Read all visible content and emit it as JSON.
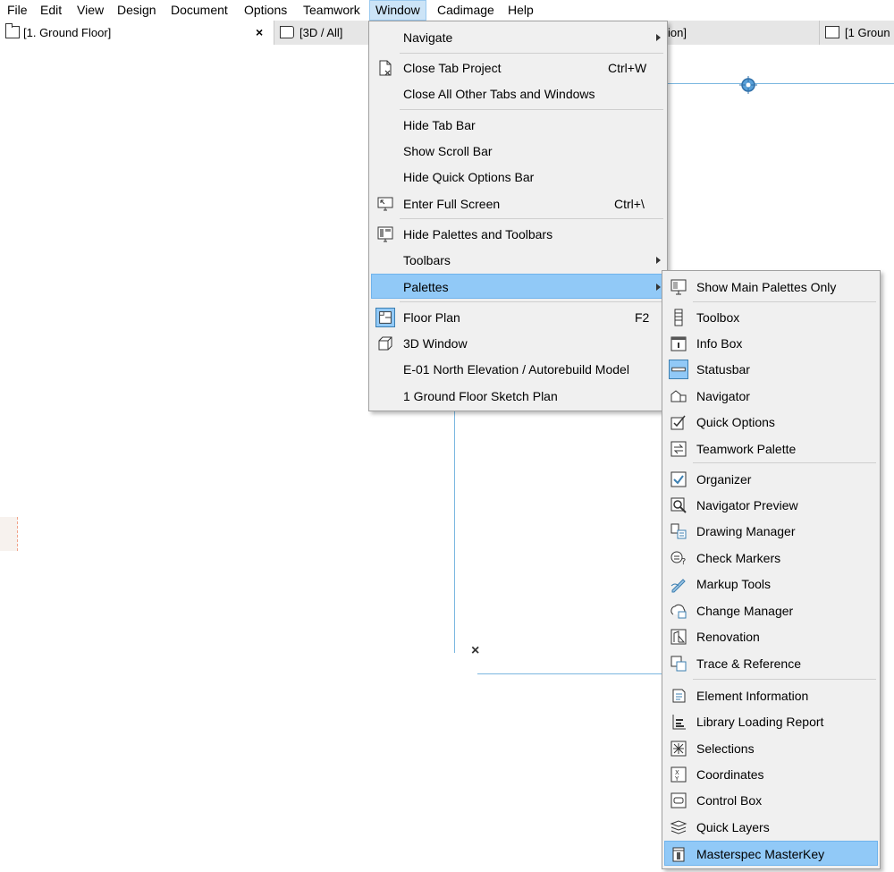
{
  "menubar": {
    "items": [
      "File",
      "Edit",
      "View",
      "Design",
      "Document",
      "Options",
      "Teamwork",
      "Window",
      "Cadimage",
      "Help"
    ],
    "active": "Window"
  },
  "tabs": {
    "floor_plan": "[1. Ground Floor]",
    "three_d": "[3D / All]",
    "partial": "ion]",
    "right": "[1 Groun",
    "close_glyph": "×"
  },
  "window_menu": {
    "navigate": "Navigate",
    "close_tab_project": "Close Tab Project",
    "close_tab_project_shortcut": "Ctrl+W",
    "close_all_other": "Close All Other Tabs and Windows",
    "hide_tab_bar": "Hide Tab Bar",
    "show_scroll_bar": "Show Scroll Bar",
    "hide_quick_options": "Hide Quick Options Bar",
    "enter_full_screen": "Enter Full Screen",
    "enter_full_screen_shortcut": "Ctrl+\\",
    "hide_palettes": "Hide Palettes and Toolbars",
    "toolbars": "Toolbars",
    "palettes": "Palettes",
    "floor_plan": "Floor Plan",
    "floor_plan_shortcut": "F2",
    "three_d_window": "3D Window",
    "elevation": "E-01 North Elevation / Autorebuild Model",
    "sketch_plan": "1 Ground Floor Sketch Plan"
  },
  "palettes_menu": {
    "show_main": "Show Main Palettes Only",
    "toolbox": "Toolbox",
    "info_box": "Info Box",
    "statusbar": "Statusbar",
    "navigator": "Navigator",
    "quick_options": "Quick Options",
    "teamwork_palette": "Teamwork Palette",
    "organizer": "Organizer",
    "navigator_preview": "Navigator Preview",
    "drawing_manager": "Drawing Manager",
    "check_markers": "Check Markers",
    "markup_tools": "Markup Tools",
    "change_manager": "Change Manager",
    "renovation": "Renovation",
    "trace_reference": "Trace & Reference",
    "element_information": "Element Information",
    "library_loading_report": "Library Loading Report",
    "selections": "Selections",
    "coordinates": "Coordinates",
    "control_box": "Control Box",
    "quick_layers": "Quick Layers",
    "masterspec": "Masterspec MasterKey"
  },
  "canvas": {
    "cross_glyph": "×"
  },
  "colors": {
    "highlight": "#91c9f7",
    "menu_bg": "#f0f0f0",
    "guide_line": "#7ab7e0"
  }
}
